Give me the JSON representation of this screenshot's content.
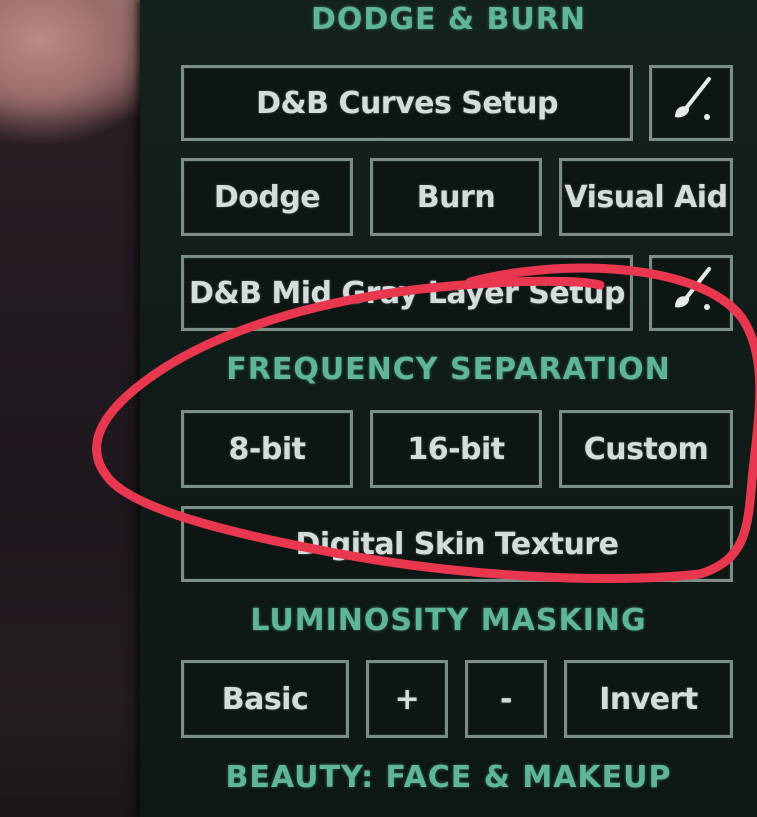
{
  "sections": {
    "dodge_burn": {
      "title": "DODGE & BURN",
      "curves_setup": "D&B  Curves Setup",
      "dodge": "Dodge",
      "burn": "Burn",
      "visual_aid": "Visual Aid",
      "mid_gray_setup": "D&B Mid Gray Layer Setup"
    },
    "frequency_separation": {
      "title": "FREQUENCY  SEPARATION",
      "bit8": "8-bit",
      "bit16": "16-bit",
      "custom": "Custom",
      "digital_skin_texture": "Digital Skin Texture"
    },
    "luminosity_masking": {
      "title": "LUMINOSITY  MASKING",
      "basic": "Basic",
      "plus": "+",
      "minus": "-",
      "invert": "Invert"
    },
    "beauty": {
      "title": "BEAUTY: FACE & MAKEUP"
    }
  },
  "icons": {
    "brush": "brush-icon"
  },
  "colors": {
    "panel_background": "#101b18",
    "section_title": "#5fb59a",
    "button_border": "#7c8c86",
    "button_text": "#d6dcd9",
    "annotation_circle": "#e8374f"
  }
}
